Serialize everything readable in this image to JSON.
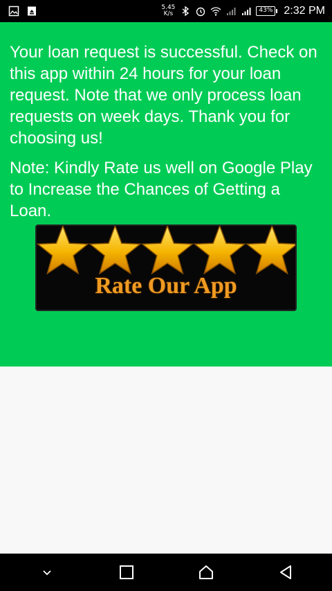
{
  "status_bar": {
    "net_speed_value": "5.45",
    "net_speed_unit": "K/s",
    "battery": "43%",
    "time": "2:32 PM"
  },
  "main": {
    "message": "Your loan request is successful. Check on this app within 24 hours for your loan request. Note that we only process loan requests on week days. Thank you for choosing us!",
    "note": "Note: Kindly Rate us well on Google Play to Increase the Chances of Getting a Loan.",
    "rate_button_label": "Rate Our App",
    "rating_stars": 5
  },
  "colors": {
    "background": "#00cc55",
    "star": "#f5b400",
    "rate_text": "#f09a22"
  }
}
